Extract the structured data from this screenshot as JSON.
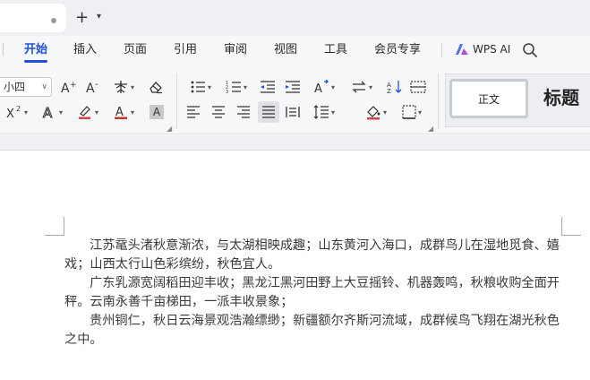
{
  "tabstrip": {
    "new_tab": "+"
  },
  "menu": {
    "items": [
      "开始",
      "插入",
      "页面",
      "引用",
      "审阅",
      "视图",
      "工具",
      "会员专享"
    ],
    "active_index": 0,
    "wps_ai": "WPS AI"
  },
  "ribbon": {
    "font_size": "小四",
    "shading_letter": "A",
    "styles": {
      "normal": "正文",
      "heading": "标题"
    }
  },
  "document": {
    "paragraphs": [
      "江苏鼋头渚秋意渐浓，与太湖相映成趣；山东黄河入海口，成群鸟儿在湿地觅食、嬉戏；山西太行山色彩缤纷，秋色宜人。",
      "广东乳源宽阔稻田迎丰收；黑龙江黑河田野上大豆摇铃、机器轰鸣，秋粮收购全面开秤。云南永善千亩梯田，一派丰收景象；",
      "贵州铜仁，秋日云海景观浩瀚缥缈；新疆额尔齐斯河流域，成群候鸟飞翔在湖光秋色之中。"
    ]
  },
  "colors": {
    "accent": "#1e50dc",
    "font_color_bar": "#c0392b",
    "highlight_bar": "#d64545"
  }
}
